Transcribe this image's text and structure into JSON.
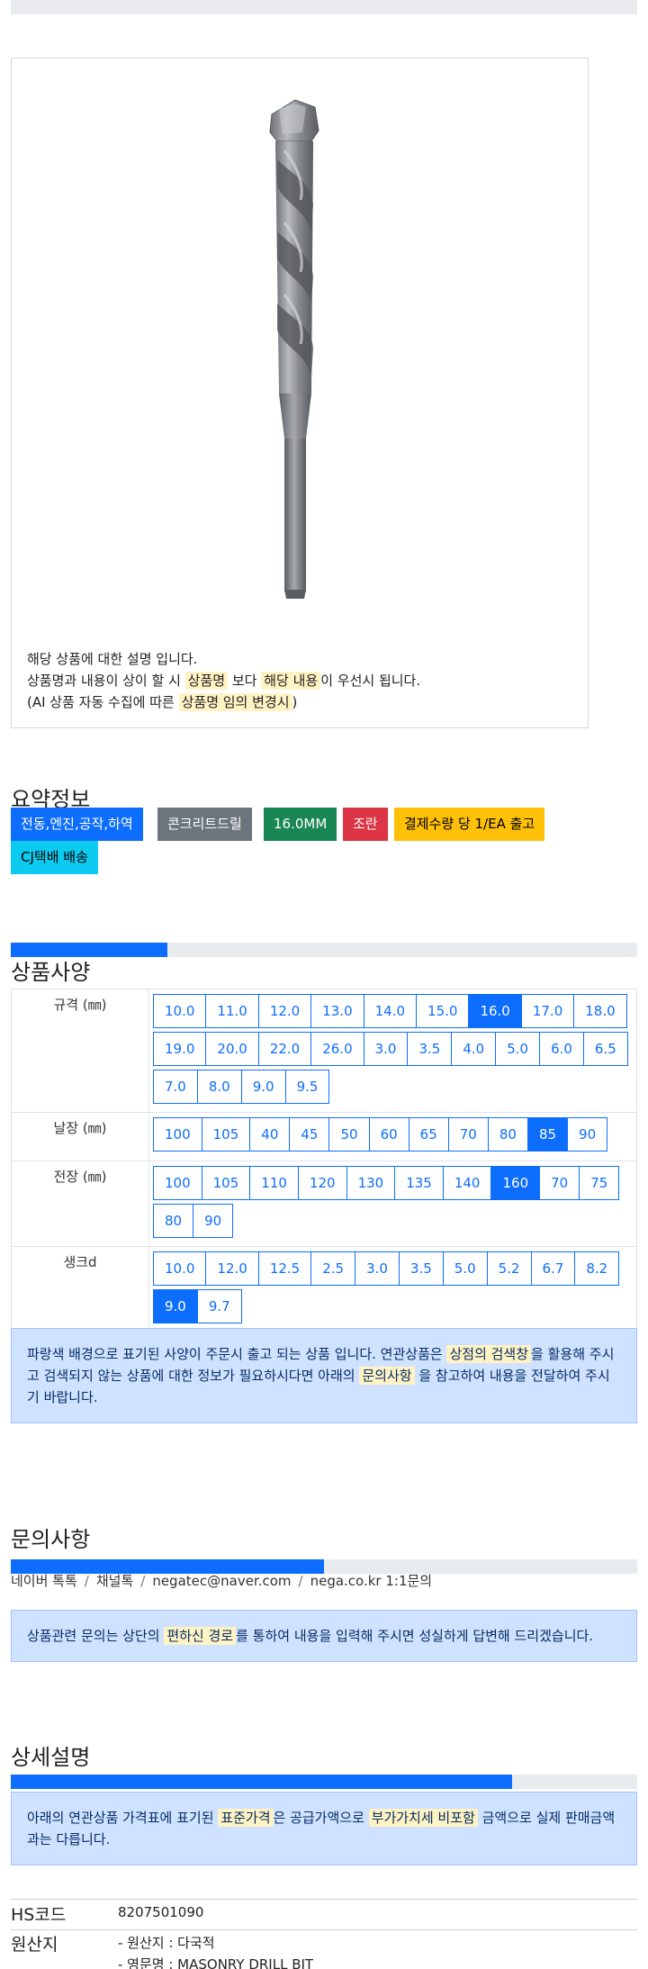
{
  "product": {
    "image_alt": "masonry drill bit"
  },
  "description": {
    "line1": "해당 상품에 대한 설명 입니다.",
    "line2_a": "상품명과 내용이 상이 할 시",
    "line2_hl1": "상품명",
    "line2_b": "보다",
    "line2_hl2": "해당 내용",
    "line2_c": "이 우선시 됩니다.",
    "line3_a": "(AI 상품 자동 수집에 따른",
    "line3_hl": "상품명 임의 변경시",
    "line3_b": ")"
  },
  "summary": {
    "title": "요약정보",
    "tags": [
      {
        "label": "전동,엔진,공작,하역",
        "color": "#0d6efd",
        "text_color": "#ffffff"
      },
      {
        "label": "콘크리트드릴",
        "color": "#6c757d",
        "text_color": "#ffffff"
      },
      {
        "label": "16.0MM",
        "color": "#198754",
        "text_color": "#ffffff"
      },
      {
        "label": "조란",
        "color": "#dc3545",
        "text_color": "#ffffff"
      },
      {
        "label": "결제수량 당 1/EA 출고",
        "color": "#ffc107",
        "text_color": "#000000"
      },
      {
        "label": "CJ택배 배송",
        "color": "#0dcaf0",
        "text_color": "#000000"
      }
    ]
  },
  "specs": {
    "title": "상품사양",
    "progress_fraction": 0.25,
    "rows": [
      {
        "label": "규격 (㎜)",
        "options": [
          "10.0",
          "11.0",
          "12.0",
          "13.0",
          "14.0",
          "15.0",
          "16.0",
          "17.0",
          "18.0",
          "19.0",
          "20.0",
          "22.0",
          "26.0",
          "3.0",
          "3.5",
          "4.0",
          "5.0",
          "6.0",
          "6.5",
          "7.0",
          "8.0",
          "9.0",
          "9.5"
        ],
        "selected": "16.0"
      },
      {
        "label": "날장 (㎜)",
        "options": [
          "100",
          "105",
          "40",
          "45",
          "50",
          "60",
          "65",
          "70",
          "80",
          "85",
          "90"
        ],
        "selected": "85"
      },
      {
        "label": "전장 (㎜)",
        "options": [
          "100",
          "105",
          "110",
          "120",
          "130",
          "135",
          "140",
          "160",
          "70",
          "75",
          "80",
          "90"
        ],
        "selected": "160"
      },
      {
        "label": "생크d",
        "options": [
          "10.0",
          "12.0",
          "12.5",
          "2.5",
          "3.0",
          "3.5",
          "5.0",
          "5.2",
          "6.7",
          "8.2",
          "9.0",
          "9.7"
        ],
        "selected": "9.0"
      }
    ],
    "notice_a": "파랑색 배경으로 표기된 사양이 주문시 출고 되는 상품 입니다. 연관상품은",
    "notice_hl1": "상점의 검색창",
    "notice_b": "을 활용해 주시고 검색되지 않는 상품에 대한 정보가 필요하시다면 아래의",
    "notice_hl2": "문의사항",
    "notice_c": "을 참고하여 내용을 전달하여 주시기 바랍니다."
  },
  "inquiry": {
    "title": "문의사항",
    "progress_fraction": 0.5,
    "channels": [
      "네이버 톡톡",
      "채널톡",
      "negatec@naver.com",
      "nega.co.kr 1:1문의"
    ],
    "notice_a": "상품관련 문의는 상단의",
    "notice_hl": "편하신 경로",
    "notice_b": "를 통하여 내용을 입력해 주시면 성실하게 답변해 드리겠습니다."
  },
  "detail": {
    "title": "상세설명",
    "progress_fraction": 0.8,
    "notice_a": "아래의 연관상품 가격표에 표기된",
    "notice_hl1": "표준가격",
    "notice_b": "은 공급가액으로",
    "notice_hl2": "부가가치세 비포함",
    "notice_c": "금액으로 실제 판매금액과는 다릅니다."
  },
  "info": {
    "hs_label": "HS코드",
    "hs_value": "8207501090",
    "origin_label": "원산지",
    "origin_line1": "- 원산지 : 다국적",
    "origin_line2": "- 영문명 : MASONRY DRILL BIT"
  }
}
